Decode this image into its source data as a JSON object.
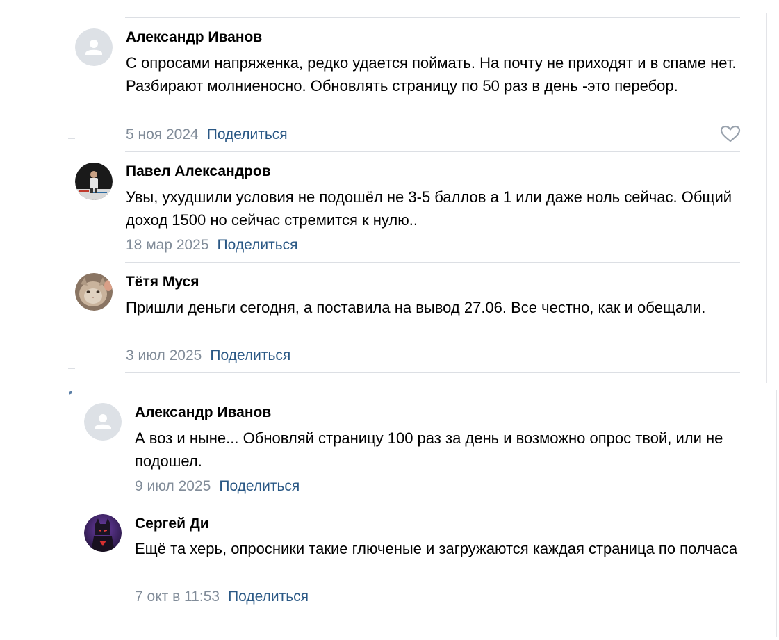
{
  "thread": {
    "comments": [
      {
        "author": "Александр Иванов",
        "text": "С опросами напряженка, редко удается поймать. На почту не приходят и в спаме нет. Разбирают молниеносно. Обновлять страницу по 50 раз в день -это перебор.",
        "date": "5 ноя 2024",
        "share": "Поделиться",
        "avatar": "default-user-icon"
      },
      {
        "author": "Павел Александров",
        "text": "Увы, ухудшили условия не подошёл не 3-5 баллов а 1 или даже ноль сейчас. Общий доход 1500 но сейчас стремится к нулю..",
        "date": "18 мар 2025",
        "share": "Поделиться",
        "avatar": "person-photo"
      },
      {
        "author": "Тётя Муся",
        "text": "Пришли деньги сегодня, а поставила на вывод 27.06. Все честно, как и обещали.",
        "date": "3 июл 2025",
        "share": "Поделиться",
        "avatar": "cat-photo"
      }
    ],
    "replies": [
      {
        "author": "Александр Иванов",
        "text": "А воз и ныне... Обновляй страницу 100 раз за день и возможно опрос твой, или не подошел.",
        "date": "9 июл 2025",
        "share": "Поделиться",
        "avatar": "default-user-icon"
      },
      {
        "author": "Сергей Ди",
        "text": "Ещё та херь, опросники такие глюченые и загружаются каждая страница по полчаса",
        "date": "7 окт в 11:53",
        "share": "Поделиться",
        "avatar": "superhero-photo"
      }
    ]
  },
  "colors": {
    "link": "#2a5885",
    "date": "#818c99",
    "divider": "#dcdfe4",
    "default_avatar_bg": "#dde1e6",
    "default_avatar_fg": "#ffffff"
  },
  "icons": {
    "like": "heart-outline-icon"
  }
}
